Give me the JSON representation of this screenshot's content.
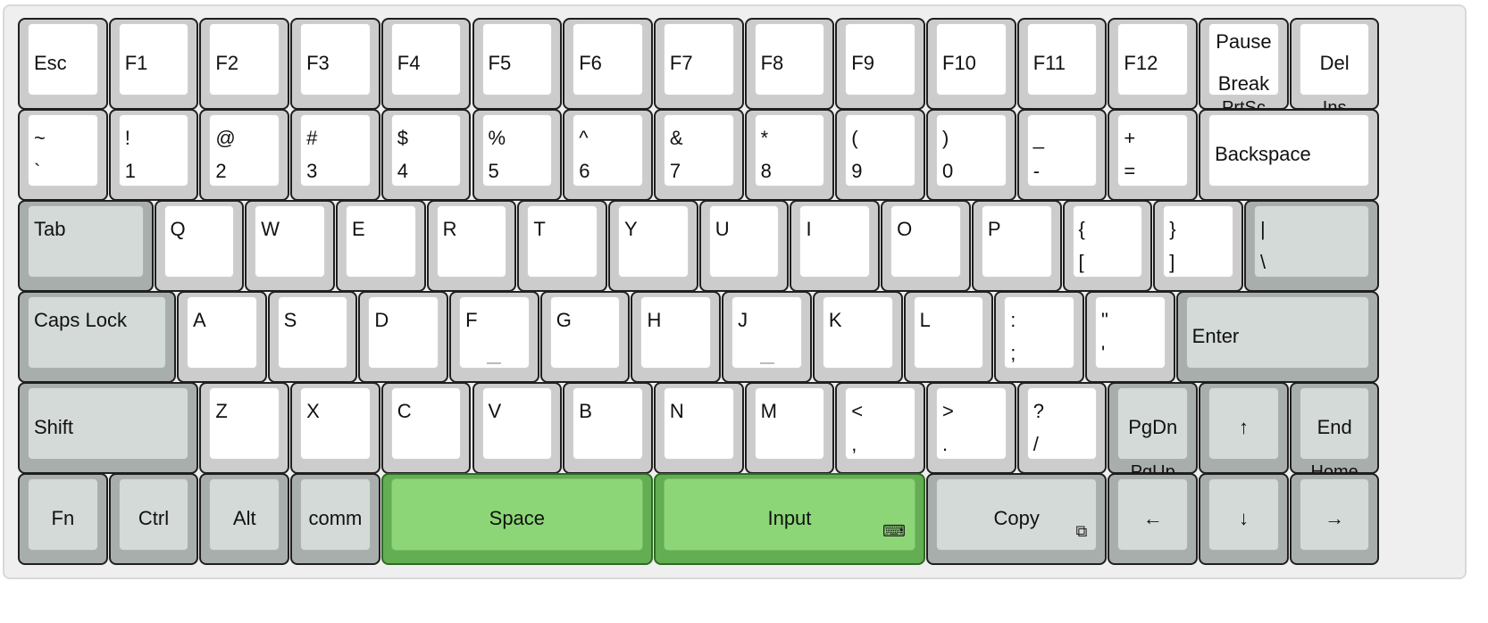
{
  "rows": [
    [
      {
        "name": "esc",
        "label": "Esc",
        "style": "alpha",
        "layout": "mid"
      },
      {
        "name": "f1",
        "label": "F1",
        "style": "alpha",
        "layout": "mid"
      },
      {
        "name": "f2",
        "label": "F2",
        "style": "alpha",
        "layout": "mid"
      },
      {
        "name": "f3",
        "label": "F3",
        "style": "alpha",
        "layout": "mid"
      },
      {
        "name": "f4",
        "label": "F4",
        "style": "alpha",
        "layout": "mid"
      },
      {
        "name": "f5",
        "label": "F5",
        "style": "alpha",
        "layout": "mid"
      },
      {
        "name": "f6",
        "label": "F6",
        "style": "alpha",
        "layout": "mid"
      },
      {
        "name": "f7",
        "label": "F7",
        "style": "alpha",
        "layout": "mid"
      },
      {
        "name": "f8",
        "label": "F8",
        "style": "alpha",
        "layout": "mid"
      },
      {
        "name": "f9",
        "label": "F9",
        "style": "alpha",
        "layout": "mid"
      },
      {
        "name": "f10",
        "label": "F10",
        "style": "alpha",
        "layout": "mid"
      },
      {
        "name": "f11",
        "label": "F11",
        "style": "alpha",
        "layout": "mid"
      },
      {
        "name": "f12",
        "label": "F12",
        "style": "alpha",
        "layout": "mid"
      },
      {
        "name": "pause",
        "top": "Pause",
        "bottom": "Break",
        "sub": "PrtSc",
        "style": "alpha",
        "layout": "cstack"
      },
      {
        "name": "del",
        "label": "Del",
        "sub": "Ins",
        "style": "alpha",
        "layout": "center"
      }
    ],
    [
      {
        "name": "backtick",
        "top": "~",
        "bottom": "`",
        "style": "alpha",
        "layout": "stack"
      },
      {
        "name": "1",
        "top": "!",
        "bottom": "1",
        "style": "alpha",
        "layout": "stack"
      },
      {
        "name": "2",
        "top": "@",
        "bottom": "2",
        "style": "alpha",
        "layout": "stack"
      },
      {
        "name": "3",
        "top": "#",
        "bottom": "3",
        "style": "alpha",
        "layout": "stack"
      },
      {
        "name": "4",
        "top": "$",
        "bottom": "4",
        "style": "alpha",
        "layout": "stack"
      },
      {
        "name": "5",
        "top": "%",
        "bottom": "5",
        "style": "alpha",
        "layout": "stack"
      },
      {
        "name": "6",
        "top": "^",
        "bottom": "6",
        "style": "alpha",
        "layout": "stack"
      },
      {
        "name": "7",
        "top": "&",
        "bottom": "7",
        "style": "alpha",
        "layout": "stack"
      },
      {
        "name": "8",
        "top": "*",
        "bottom": "8",
        "style": "alpha",
        "layout": "stack"
      },
      {
        "name": "9",
        "top": "(",
        "bottom": "9",
        "style": "alpha",
        "layout": "stack"
      },
      {
        "name": "0",
        "top": ")",
        "bottom": "0",
        "style": "alpha",
        "layout": "stack"
      },
      {
        "name": "minus",
        "top": "_",
        "bottom": "-",
        "style": "alpha",
        "layout": "stack"
      },
      {
        "name": "equals",
        "top": "+",
        "bottom": "=",
        "style": "alpha",
        "layout": "stack"
      },
      {
        "name": "backspace",
        "label": "Backspace",
        "style": "alpha",
        "layout": "mid"
      }
    ],
    [
      {
        "name": "tab",
        "label": "Tab",
        "style": "mod",
        "layout": "top"
      },
      {
        "name": "q",
        "label": "Q",
        "style": "alpha",
        "layout": "top"
      },
      {
        "name": "w",
        "label": "W",
        "style": "alpha",
        "layout": "top"
      },
      {
        "name": "e",
        "label": "E",
        "style": "alpha",
        "layout": "top"
      },
      {
        "name": "r",
        "label": "R",
        "style": "alpha",
        "layout": "top"
      },
      {
        "name": "t",
        "label": "T",
        "style": "alpha",
        "layout": "top"
      },
      {
        "name": "y",
        "label": "Y",
        "style": "alpha",
        "layout": "top"
      },
      {
        "name": "u",
        "label": "U",
        "style": "alpha",
        "layout": "top"
      },
      {
        "name": "i",
        "label": "I",
        "style": "alpha",
        "layout": "top"
      },
      {
        "name": "o",
        "label": "O",
        "style": "alpha",
        "layout": "top"
      },
      {
        "name": "p",
        "label": "P",
        "style": "alpha",
        "layout": "top"
      },
      {
        "name": "lbracket",
        "top": "{",
        "bottom": "[",
        "style": "alpha",
        "layout": "stack"
      },
      {
        "name": "rbracket",
        "top": "}",
        "bottom": "]",
        "style": "alpha",
        "layout": "stack"
      },
      {
        "name": "backslash",
        "top": "|",
        "bottom": "\\",
        "style": "mod",
        "layout": "stack"
      }
    ],
    [
      {
        "name": "caps-lock",
        "label": "Caps Lock",
        "style": "mod",
        "layout": "top"
      },
      {
        "name": "a",
        "label": "A",
        "style": "alpha",
        "layout": "top"
      },
      {
        "name": "s",
        "label": "S",
        "style": "alpha",
        "layout": "top"
      },
      {
        "name": "d",
        "label": "D",
        "style": "alpha",
        "layout": "top"
      },
      {
        "name": "f",
        "label": "F",
        "style": "alpha",
        "layout": "top",
        "bump": true
      },
      {
        "name": "g",
        "label": "G",
        "style": "alpha",
        "layout": "top"
      },
      {
        "name": "h",
        "label": "H",
        "style": "alpha",
        "layout": "top"
      },
      {
        "name": "j",
        "label": "J",
        "style": "alpha",
        "layout": "top",
        "bump": true
      },
      {
        "name": "k",
        "label": "K",
        "style": "alpha",
        "layout": "top"
      },
      {
        "name": "l",
        "label": "L",
        "style": "alpha",
        "layout": "top"
      },
      {
        "name": "semicolon",
        "top": ":",
        "bottom": ";",
        "style": "alpha",
        "layout": "stack"
      },
      {
        "name": "quote",
        "top": "\"",
        "bottom": "'",
        "style": "alpha",
        "layout": "stack"
      },
      {
        "name": "enter",
        "label": "Enter",
        "style": "mod",
        "layout": "mid"
      }
    ],
    [
      {
        "name": "shift",
        "label": "Shift",
        "style": "mod",
        "layout": "mid"
      },
      {
        "name": "z",
        "label": "Z",
        "style": "alpha",
        "layout": "top"
      },
      {
        "name": "x",
        "label": "X",
        "style": "alpha",
        "layout": "top"
      },
      {
        "name": "c",
        "label": "C",
        "style": "alpha",
        "layout": "top"
      },
      {
        "name": "v",
        "label": "V",
        "style": "alpha",
        "layout": "top"
      },
      {
        "name": "b",
        "label": "B",
        "style": "alpha",
        "layout": "top"
      },
      {
        "name": "n",
        "label": "N",
        "style": "alpha",
        "layout": "top"
      },
      {
        "name": "m",
        "label": "M",
        "style": "alpha",
        "layout": "top"
      },
      {
        "name": "comma",
        "top": "<",
        "bottom": ",",
        "style": "alpha",
        "layout": "stack"
      },
      {
        "name": "period",
        "top": ">",
        "bottom": ".",
        "style": "alpha",
        "layout": "stack"
      },
      {
        "name": "slash",
        "top": "?",
        "bottom": "/",
        "style": "alpha",
        "layout": "stack"
      },
      {
        "name": "pgdn",
        "label": "PgDn",
        "sub": "PgUp",
        "style": "mod",
        "layout": "center"
      },
      {
        "name": "arrow-up",
        "label": "↑",
        "style": "mod",
        "layout": "center",
        "icon": "arrow-up-icon"
      },
      {
        "name": "end",
        "label": "End",
        "sub": "Home",
        "style": "mod",
        "layout": "center"
      }
    ],
    [
      {
        "name": "fn",
        "label": "Fn",
        "style": "mod",
        "layout": "center"
      },
      {
        "name": "ctrl",
        "label": "Ctrl",
        "style": "mod",
        "layout": "center"
      },
      {
        "name": "alt",
        "label": "Alt",
        "style": "mod",
        "layout": "center"
      },
      {
        "name": "comm",
        "label": "comm",
        "style": "mod",
        "layout": "center"
      },
      {
        "name": "space",
        "label": "Space",
        "style": "green",
        "layout": "center"
      },
      {
        "name": "input",
        "label": "Input",
        "style": "green",
        "layout": "center",
        "corner_icon": "⌨",
        "corner_icon_name": "keyboard-icon"
      },
      {
        "name": "copy",
        "label": "Copy",
        "style": "mod",
        "layout": "center",
        "corner_icon": "⧉",
        "corner_icon_name": "copy-icon"
      },
      {
        "name": "arrow-left",
        "label": "←",
        "style": "mod",
        "layout": "center",
        "icon": "arrow-left-icon"
      },
      {
        "name": "arrow-down",
        "label": "↓",
        "style": "mod",
        "layout": "center",
        "icon": "arrow-down-icon"
      },
      {
        "name": "arrow-right",
        "label": "→",
        "style": "mod",
        "layout": "center",
        "icon": "arrow-right-icon"
      }
    ]
  ],
  "colors": {
    "alpha_base": "#cccccc",
    "alpha_cap": "#ffffff",
    "mod_base": "#a8aeab",
    "mod_cap": "#d4dad7",
    "green_base": "#63ad52",
    "green_cap": "#8dd677"
  }
}
